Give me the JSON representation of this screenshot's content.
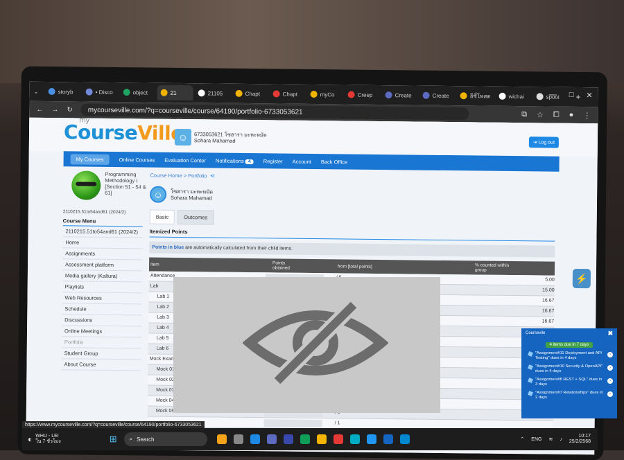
{
  "browser": {
    "tabs": [
      {
        "label": "storyb",
        "color": "#4a90e2"
      },
      {
        "label": "• Disco",
        "color": "#7289da"
      },
      {
        "label": "object",
        "color": "#1ea362"
      },
      {
        "label": "21",
        "color": "#f0b400",
        "active": true
      },
      {
        "label": "21105",
        "color": "#ffffff"
      },
      {
        "label": "Chapt",
        "color": "#f0b400"
      },
      {
        "label": "Chapt",
        "color": "#e53935"
      },
      {
        "label": "myCo",
        "color": "#f0b400"
      },
      {
        "label": "Creep",
        "color": "#e53935"
      },
      {
        "label": "Create",
        "color": "#5c6bc0"
      },
      {
        "label": "Create",
        "color": "#5c6bc0"
      },
      {
        "label": "อีซี่โพสต",
        "color": "#f0b400"
      },
      {
        "label": "wichai",
        "color": "#ffffff"
      },
      {
        "label": "spooi",
        "color": "#dddddd"
      }
    ],
    "url": "mycourseville.com/?q=courseville/course/64190/portfolio-6733053621",
    "window_controls": [
      "—",
      "□",
      "✕"
    ],
    "new_tab": "+"
  },
  "header": {
    "logo_my": "my",
    "logo_course": "Course",
    "logo_ville": "Ville",
    "user_id_line": "6733053621 โซฮารา มะหะหมัด",
    "user_name": "Sohara Mahamad",
    "logout_label": "Log out"
  },
  "nav": {
    "items": [
      "My Courses",
      "Online Courses",
      "Evaluation Center",
      "Notifications",
      "Register",
      "Account",
      "Back Office"
    ],
    "notifications_count": "4"
  },
  "sidebar": {
    "course_name": "Programming Methodology I [Section 51 - 54 & 61]",
    "course_code": "2110215.51to54and61 (2024/2)",
    "menu_title": "Course Menu",
    "menu_items": [
      "2110215.51to54and61 (2024/2)",
      "Home",
      "Assignments",
      "Assessment platform",
      "Media gallery (Kaltura)",
      "Playlists",
      "Web Resources",
      "Schedule",
      "Discussions",
      "Online Meetings",
      "Portfolio",
      "Student Group",
      "About Course"
    ]
  },
  "content": {
    "breadcrumb": "Course Home > Portfolio",
    "thai_name": "โซฮารา มะหะหมัด",
    "eng_name": "Sohara Mahamad",
    "tab_basic": "Basic",
    "tab_outcomes": "Outcomes",
    "section_title": "Itemized Points",
    "note_bold": "Points in blue",
    "note_rest": " are automatically calculated from their child items.",
    "col_item": "Item",
    "col_points": "Points obtained",
    "col_from": "from [total points]",
    "col_pct": "% counted within group",
    "rows": [
      {
        "label": "Attendance",
        "pts": "/ 5",
        "pct": "5.00",
        "sub": false
      },
      {
        "label": "Lab",
        "pts": "",
        "pct": "15.00",
        "sub": false
      },
      {
        "label": "Lab 1",
        "pts": "",
        "pct": "16.67",
        "sub": true
      },
      {
        "label": "Lab 2",
        "pts": "",
        "pct": "16.67",
        "sub": true
      },
      {
        "label": "Lab 3",
        "pts": "",
        "pct": "16.67",
        "sub": true
      },
      {
        "label": "Lab 4",
        "pts": "",
        "pct": "16.67",
        "sub": true
      },
      {
        "label": "Lab 5",
        "pts": "",
        "pct": "",
        "sub": true
      },
      {
        "label": "Lab 6",
        "pts": "",
        "pct": "",
        "sub": true
      },
      {
        "label": "Mock Exam",
        "pts": "",
        "pct": "",
        "sub": false
      },
      {
        "label": "Mock 01",
        "pts": "",
        "pct": "",
        "sub": true
      },
      {
        "label": "Mock 02",
        "pts": "",
        "pct": "",
        "sub": true
      },
      {
        "label": "Mock 03",
        "pts": "",
        "pct": "",
        "sub": true
      },
      {
        "label": "Mock 04",
        "pts": "",
        "pct": "",
        "sub": true
      },
      {
        "label": "Mock 05",
        "pts": "/ 1",
        "pct": "",
        "sub": true
      },
      {
        "label": "",
        "pts": "/ 1",
        "pct": "",
        "sub": true
      }
    ]
  },
  "popup": {
    "title": "Coursevile",
    "due_badge": "4 items due in 7 days",
    "items": [
      "\"Assignment#11 Deployment and API Testing\" dues in 4 days",
      "\"Assignment#10 Security & OpenAPI\" dues in 4 days",
      "\"Assignment#8 REST + SQL\" dues in 3 days",
      "\"Assignment#7 Relationships\" dues in 2 days"
    ]
  },
  "status_url": "https://www.mycourseville.com/?q=courseville/course/64190/portfolio-6733053621",
  "taskbar": {
    "weather_title": "WHU - LEI",
    "weather_sub": "ใน 7 ชั่วโมง",
    "search_label": "Search",
    "lang": "ENG",
    "time": "10:17",
    "date": "25/2/2568"
  }
}
